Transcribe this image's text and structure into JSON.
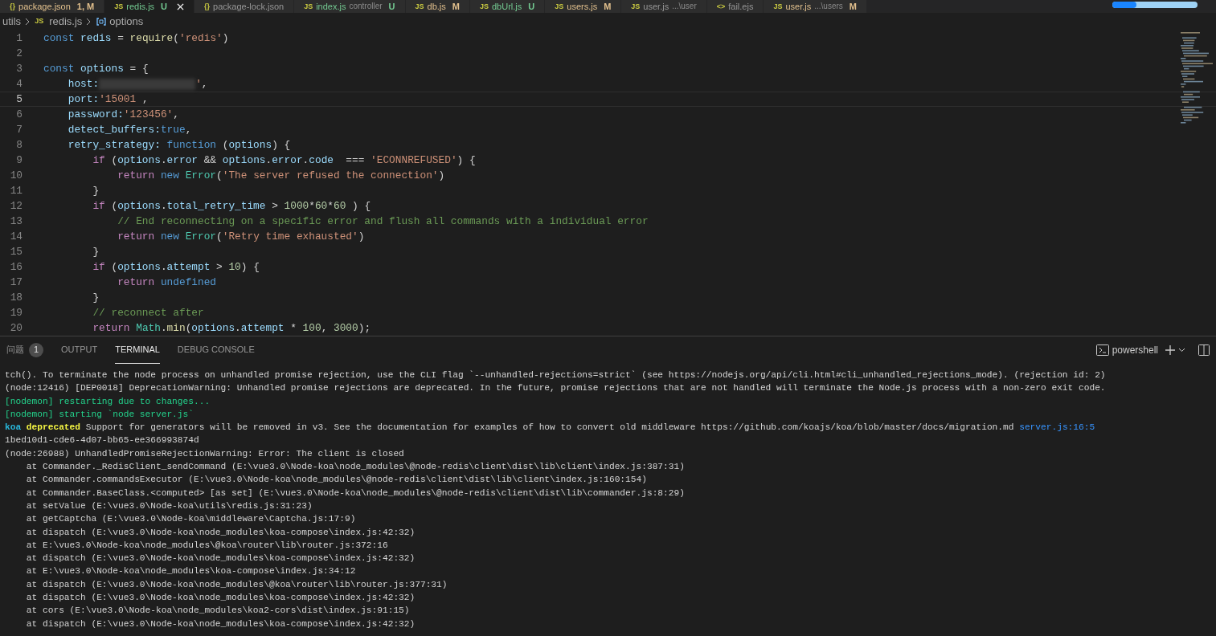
{
  "tabs": [
    {
      "icon_text": "{}",
      "label": "package.json",
      "status": "1, M",
      "color": "#e2c08d",
      "selected": false
    },
    {
      "icon_text": "JS",
      "label": "redis.js",
      "status": "U",
      "color": "#73c991",
      "selected": true
    },
    {
      "icon_text": "{}",
      "label": "package-lock.json",
      "selected": false
    },
    {
      "icon_text": "JS",
      "label": "index.js",
      "description": "controller",
      "status": "U",
      "color": "#73c991",
      "selected": false
    },
    {
      "icon_text": "JS",
      "label": "db.js",
      "status": "M",
      "color": "#e2c08d",
      "selected": false
    },
    {
      "icon_text": "JS",
      "label": "dbUrl.js",
      "status": "U",
      "color": "#73c991",
      "selected": false
    },
    {
      "icon_text": "JS",
      "label": "users.js",
      "status": "M",
      "color": "#e2c08d",
      "selected": false
    },
    {
      "icon_text": "JS",
      "label": "user.js",
      "description": "...\\user",
      "selected": false
    },
    {
      "icon_text": "<>",
      "label": "fail.ejs",
      "selected": false
    },
    {
      "icon_text": "JS",
      "label": "user.js",
      "description": "...\\users",
      "status": "M",
      "color": "#e2c08d",
      "selected": false
    }
  ],
  "progress": {
    "level": 0.28
  },
  "breadcrumb": [
    {
      "kind": "folder",
      "label": "utils"
    },
    {
      "kind": "file",
      "icon_text": "JS",
      "label": "redis.js"
    },
    {
      "kind": "symbol",
      "label": "options"
    }
  ],
  "editor": {
    "lines": [
      {
        "number": "1",
        "current": false,
        "tokens": [
          {
            "kind": "keyword",
            "text": "const "
          },
          {
            "kind": "variable",
            "text": "redis"
          },
          {
            "kind": "plain",
            "text": " = "
          },
          {
            "kind": "function",
            "text": "require"
          },
          {
            "kind": "plain",
            "text": "("
          },
          {
            "kind": "string",
            "text": "'redis'"
          },
          {
            "kind": "plain",
            "text": ")"
          }
        ]
      },
      {
        "number": "2",
        "current": false
      },
      {
        "number": "3",
        "current": false,
        "tokens": [
          {
            "kind": "keyword",
            "text": "const "
          },
          {
            "kind": "variable",
            "text": "options"
          },
          {
            "kind": "plain",
            "text": " = {"
          }
        ]
      },
      {
        "number": "4",
        "current": false,
        "tokens": [
          {
            "kind": "variable",
            "text": "    host:"
          },
          {
            "kind": "redacted"
          },
          {
            "kind": "string",
            "text": "'"
          },
          {
            "kind": "plain",
            "text": ","
          }
        ]
      },
      {
        "number": "5",
        "current": true,
        "tokens": [
          {
            "kind": "variable",
            "text": "    port:"
          },
          {
            "kind": "string",
            "text": "'15001"
          },
          {
            "kind": "plain",
            "text": " ,"
          }
        ]
      },
      {
        "number": "6",
        "current": false,
        "tokens": [
          {
            "kind": "variable",
            "text": "    password:"
          },
          {
            "kind": "string",
            "text": "'123456'"
          },
          {
            "kind": "plain",
            "text": ","
          }
        ]
      },
      {
        "number": "7",
        "current": false,
        "tokens": [
          {
            "kind": "variable",
            "text": "    detect_buffers:"
          },
          {
            "kind": "keyword",
            "text": "true"
          },
          {
            "kind": "plain",
            "text": ","
          }
        ]
      },
      {
        "number": "8",
        "current": false,
        "tokens": [
          {
            "kind": "variable",
            "text": "    retry_strategy: "
          },
          {
            "kind": "keyword",
            "text": "function"
          },
          {
            "kind": "plain",
            "text": " ("
          },
          {
            "kind": "variable",
            "text": "options"
          },
          {
            "kind": "plain",
            "text": ") {"
          }
        ]
      },
      {
        "number": "9",
        "current": false,
        "tokens": [
          {
            "kind": "control",
            "text": "        if"
          },
          {
            "kind": "plain",
            "text": " ("
          },
          {
            "kind": "variable",
            "text": "options"
          },
          {
            "kind": "plain",
            "text": "."
          },
          {
            "kind": "variable",
            "text": "error"
          },
          {
            "kind": "plain",
            "text": " && "
          },
          {
            "kind": "variable",
            "text": "options"
          },
          {
            "kind": "plain",
            "text": "."
          },
          {
            "kind": "variable",
            "text": "error"
          },
          {
            "kind": "plain",
            "text": "."
          },
          {
            "kind": "variable",
            "text": "code"
          },
          {
            "kind": "plain",
            "text": "  === "
          },
          {
            "kind": "string",
            "text": "'ECONNREFUSED'"
          },
          {
            "kind": "plain",
            "text": ") {"
          }
        ]
      },
      {
        "number": "10",
        "current": false,
        "tokens": [
          {
            "kind": "control",
            "text": "            return "
          },
          {
            "kind": "keyword",
            "text": "new "
          },
          {
            "kind": "class",
            "text": "Error"
          },
          {
            "kind": "plain",
            "text": "("
          },
          {
            "kind": "string",
            "text": "'The server refused the connection'"
          },
          {
            "kind": "plain",
            "text": ")"
          }
        ]
      },
      {
        "number": "11",
        "current": false,
        "tokens": [
          {
            "kind": "plain",
            "text": "        }"
          }
        ]
      },
      {
        "number": "12",
        "current": false,
        "tokens": [
          {
            "kind": "control",
            "text": "        if"
          },
          {
            "kind": "plain",
            "text": " ("
          },
          {
            "kind": "variable",
            "text": "options"
          },
          {
            "kind": "plain",
            "text": "."
          },
          {
            "kind": "variable",
            "text": "total_retry_time"
          },
          {
            "kind": "plain",
            "text": " > "
          },
          {
            "kind": "number",
            "text": "1000"
          },
          {
            "kind": "plain",
            "text": "*"
          },
          {
            "kind": "number",
            "text": "60"
          },
          {
            "kind": "plain",
            "text": "*"
          },
          {
            "kind": "number",
            "text": "60"
          },
          {
            "kind": "plain",
            "text": " ) {"
          }
        ]
      },
      {
        "number": "13",
        "current": false,
        "tokens": [
          {
            "kind": "comment",
            "text": "            // End reconnecting on a specific error and flush all commands with a individual error"
          }
        ]
      },
      {
        "number": "14",
        "current": false,
        "tokens": [
          {
            "kind": "control",
            "text": "            return "
          },
          {
            "kind": "keyword",
            "text": "new "
          },
          {
            "kind": "class",
            "text": "Error"
          },
          {
            "kind": "plain",
            "text": "("
          },
          {
            "kind": "string",
            "text": "'Retry time exhausted'"
          },
          {
            "kind": "plain",
            "text": ")"
          }
        ]
      },
      {
        "number": "15",
        "current": false,
        "tokens": [
          {
            "kind": "plain",
            "text": "        }"
          }
        ]
      },
      {
        "number": "16",
        "current": false,
        "tokens": [
          {
            "kind": "control",
            "text": "        if"
          },
          {
            "kind": "plain",
            "text": " ("
          },
          {
            "kind": "variable",
            "text": "options"
          },
          {
            "kind": "plain",
            "text": "."
          },
          {
            "kind": "variable",
            "text": "attempt"
          },
          {
            "kind": "plain",
            "text": " > "
          },
          {
            "kind": "number",
            "text": "10"
          },
          {
            "kind": "plain",
            "text": ") {"
          }
        ]
      },
      {
        "number": "17",
        "current": false,
        "tokens": [
          {
            "kind": "control",
            "text": "            return "
          },
          {
            "kind": "keyword",
            "text": "undefined"
          }
        ]
      },
      {
        "number": "18",
        "current": false,
        "tokens": [
          {
            "kind": "plain",
            "text": "        }"
          }
        ]
      },
      {
        "number": "19",
        "current": false,
        "tokens": [
          {
            "kind": "comment",
            "text": "        // reconnect after"
          }
        ]
      },
      {
        "number": "20",
        "current": false,
        "tokens": [
          {
            "kind": "control",
            "text": "        return "
          },
          {
            "kind": "class",
            "text": "Math"
          },
          {
            "kind": "plain",
            "text": "."
          },
          {
            "kind": "function",
            "text": "min"
          },
          {
            "kind": "plain",
            "text": "("
          },
          {
            "kind": "variable",
            "text": "options"
          },
          {
            "kind": "plain",
            "text": "."
          },
          {
            "kind": "variable",
            "text": "attempt"
          },
          {
            "kind": "plain",
            "text": " * "
          },
          {
            "kind": "number",
            "text": "100"
          },
          {
            "kind": "plain",
            "text": ", "
          },
          {
            "kind": "number",
            "text": "3000"
          },
          {
            "kind": "plain",
            "text": ");"
          }
        ]
      }
    ]
  },
  "panel": {
    "tabs": [
      {
        "label": "问题",
        "badge": "1",
        "selected": false
      },
      {
        "label": "OUTPUT",
        "selected": false
      },
      {
        "label": "TERMINAL",
        "selected": true
      },
      {
        "label": "DEBUG CONSOLE",
        "selected": false
      }
    ],
    "shell": "powershell",
    "terminal_lines": [
      {
        "tokens": [
          {
            "kind": "plain",
            "text": "tch(). To terminate the node process on unhandled promise rejection, use the CLI flag `--unhandled-rejections=strict` (see https://nodejs.org/api/cli.html#cli_unhandled_rejections_mode). (rejection id: 2)"
          }
        ]
      },
      {
        "tokens": [
          {
            "kind": "plain",
            "text": "(node:12416) [DEP0018] DeprecationWarning: Unhandled promise rejections are deprecated. In the future, promise rejections that are not handled will terminate the Node.js process with a non-zero exit code."
          }
        ]
      },
      {
        "tokens": [
          {
            "kind": "green",
            "text": "[nodemon] restarting due to changes..."
          }
        ]
      },
      {
        "tokens": [
          {
            "kind": "green",
            "text": "[nodemon] starting `node server.js`"
          }
        ]
      },
      {
        "tokens": [
          {
            "kind": "namespace",
            "text": "koa "
          },
          {
            "kind": "warning",
            "text": "deprecated"
          },
          {
            "kind": "plain",
            "text": " Support for generators will be removed in v3. See the documentation for examples of how to convert old middleware https://github.com/koajs/koa/blob/master/docs/migration.md "
          },
          {
            "kind": "link",
            "text": "server.js:16:5"
          }
        ]
      },
      {
        "tokens": [
          {
            "kind": "plain",
            "text": "1bed10d1-cde6-4d07-bb65-ee366993874d"
          }
        ]
      },
      {
        "tokens": [
          {
            "kind": "plain",
            "text": "(node:26988) UnhandledPromiseRejectionWarning: Error: The client is closed"
          }
        ]
      },
      {
        "tokens": [
          {
            "kind": "plain",
            "text": "    at Commander._RedisClient_sendCommand (E:\\vue3.0\\Node-koa\\node_modules\\@node-redis\\client\\dist\\lib\\client\\index.js:387:31)"
          }
        ]
      },
      {
        "tokens": [
          {
            "kind": "plain",
            "text": "    at Commander.commandsExecutor (E:\\vue3.0\\Node-koa\\node_modules\\@node-redis\\client\\dist\\lib\\client\\index.js:160:154)"
          }
        ]
      },
      {
        "tokens": [
          {
            "kind": "plain",
            "text": "    at Commander.BaseClass.<computed> [as set] (E:\\vue3.0\\Node-koa\\node_modules\\@node-redis\\client\\dist\\lib\\commander.js:8:29)"
          }
        ]
      },
      {
        "tokens": [
          {
            "kind": "plain",
            "text": "    at setValue (E:\\vue3.0\\Node-koa\\utils\\redis.js:31:23)"
          }
        ]
      },
      {
        "tokens": [
          {
            "kind": "plain",
            "text": "    at getCaptcha (E:\\vue3.0\\Node-koa\\middleware\\Captcha.js:17:9)"
          }
        ]
      },
      {
        "tokens": [
          {
            "kind": "plain",
            "text": "    at dispatch (E:\\vue3.0\\Node-koa\\node_modules\\koa-compose\\index.js:42:32)"
          }
        ]
      },
      {
        "tokens": [
          {
            "kind": "plain",
            "text": "    at E:\\vue3.0\\Node-koa\\node_modules\\@koa\\router\\lib\\router.js:372:16"
          }
        ]
      },
      {
        "tokens": [
          {
            "kind": "plain",
            "text": "    at dispatch (E:\\vue3.0\\Node-koa\\node_modules\\koa-compose\\index.js:42:32)"
          }
        ]
      },
      {
        "tokens": [
          {
            "kind": "plain",
            "text": "    at E:\\vue3.0\\Node-koa\\node_modules\\koa-compose\\index.js:34:12"
          }
        ]
      },
      {
        "tokens": [
          {
            "kind": "plain",
            "text": "    at dispatch (E:\\vue3.0\\Node-koa\\node_modules\\@koa\\router\\lib\\router.js:377:31)"
          }
        ]
      },
      {
        "tokens": [
          {
            "kind": "plain",
            "text": "    at dispatch (E:\\vue3.0\\Node-koa\\node_modules\\koa-compose\\index.js:42:32)"
          }
        ]
      },
      {
        "tokens": [
          {
            "kind": "plain",
            "text": "    at cors (E:\\vue3.0\\Node-koa\\node_modules\\koa2-cors\\dist\\index.js:91:15)"
          }
        ]
      },
      {
        "tokens": [
          {
            "kind": "plain",
            "text": "    at dispatch (E:\\vue3.0\\Node-koa\\node_modules\\koa-compose\\index.js:42:32)"
          }
        ]
      }
    ]
  }
}
